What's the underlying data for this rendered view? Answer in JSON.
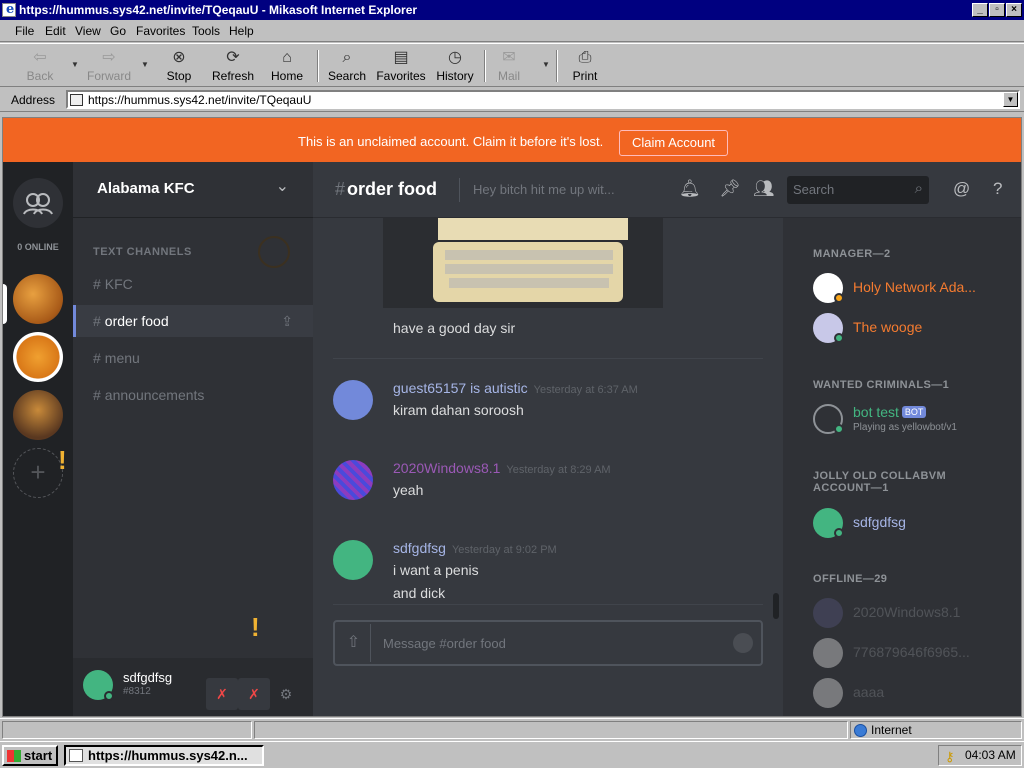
{
  "window": {
    "title": "https://hummus.sys42.net/invite/TQeqauU - Mikasoft Internet Explorer"
  },
  "menubar": [
    "File",
    "Edit",
    "View",
    "Go",
    "Favorites",
    "Tools",
    "Help"
  ],
  "toolbar": {
    "back": "Back",
    "forward": "Forward",
    "stop": "Stop",
    "refresh": "Refresh",
    "home": "Home",
    "search": "Search",
    "favorites": "Favorites",
    "history": "History",
    "mail": "Mail",
    "print": "Print"
  },
  "address": {
    "label": "Address",
    "url": "https://hummus.sys42.net/invite/TQeqauU"
  },
  "banner": {
    "message": "This is an unclaimed account. Claim it before it's lost.",
    "button": "Claim Account"
  },
  "guilds": {
    "online_label": "0 ONLINE"
  },
  "server": {
    "name": "Alabama KFC",
    "category": "TEXT CHANNELS",
    "channels": [
      "KFC",
      "order food",
      "menu",
      "announcements"
    ],
    "selected": "order food"
  },
  "user": {
    "name": "sdfgdfsg",
    "tag": "#8312"
  },
  "chat": {
    "channel": "order food",
    "topic": "Hey bitch hit me up wit...",
    "search_placeholder": "Search",
    "composer_placeholder": "Message #order food",
    "messages": [
      {
        "author": "",
        "time": "",
        "lines": [
          "have a good day sir"
        ]
      },
      {
        "author": "guest65157 is autistic",
        "time": "Yesterday at 6:37 AM",
        "lines": [
          "kiram dahan soroosh"
        ]
      },
      {
        "author": "2020Windows8.1",
        "time": "Yesterday at 8:29 AM",
        "lines": [
          "yeah"
        ]
      },
      {
        "author": "sdfgdfsg",
        "time": "Yesterday at 9:02 PM",
        "lines": [
          "i want a penis",
          "and dick"
        ]
      }
    ]
  },
  "members": {
    "categories": [
      {
        "label": "MANAGER—2"
      },
      {
        "label": "WANTED CRIMINALS—1"
      },
      {
        "label": "JOLLY OLD COLLABVM ACCOUNT—1"
      },
      {
        "label": "OFFLINE—29"
      }
    ],
    "list": [
      {
        "name": "Holy Network Ada...",
        "color": "#f47b30"
      },
      {
        "name": "The wooge",
        "color": "#f47b30"
      },
      {
        "name": "bot test",
        "color": "#43b581",
        "badge": "BOT",
        "activity": "Playing as yellowbot/v1"
      },
      {
        "name": "sdfgdfsg",
        "color": "#a6b5e6"
      },
      {
        "name": "2020Windows8.1",
        "color": "#5d6066"
      },
      {
        "name": "776879646f6965...",
        "color": "#5d6066"
      },
      {
        "name": "aaaa",
        "color": "#5d6066"
      }
    ]
  },
  "statusbar": {
    "zone": "Internet"
  },
  "taskbar": {
    "start": "start",
    "task": "https://hummus.sys42.n...",
    "clock": "04:03 AM"
  },
  "colors": {
    "banner": "#f26522",
    "blurple": "#7289da",
    "online": "#43b581",
    "bg": "#36393f"
  }
}
